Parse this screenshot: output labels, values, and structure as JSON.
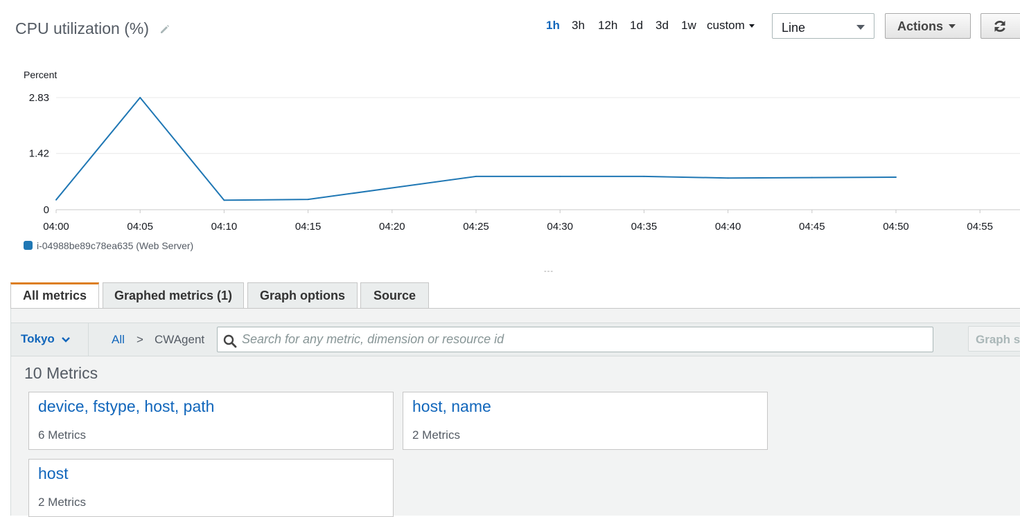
{
  "header": {
    "title": "CPU utilization (%)",
    "time_ranges": [
      "1h",
      "3h",
      "12h",
      "1d",
      "3d",
      "1w"
    ],
    "active_range": "1h",
    "custom_label": "custom",
    "viz_type": "Line",
    "actions_label": "Actions"
  },
  "chart_data": {
    "type": "line",
    "ylabel": "Percent",
    "y_ticks": [
      "2.83",
      "1.42",
      "0"
    ],
    "ylim": [
      0,
      2.83
    ],
    "x_ticks": [
      "04:00",
      "04:05",
      "04:10",
      "04:15",
      "04:20",
      "04:25",
      "04:30",
      "04:35",
      "04:40",
      "04:45",
      "04:50",
      "04:55"
    ],
    "grid": true,
    "legend_position": "bottom-left",
    "series": [
      {
        "name": "i-04988be89c78ea635 (Web Server)",
        "color": "#1f77b4",
        "x": [
          "04:00",
          "04:05",
          "04:10",
          "04:15",
          "04:20",
          "04:25",
          "04:30",
          "04:35",
          "04:40",
          "04:45",
          "04:50"
        ],
        "values": [
          0.25,
          2.83,
          0.24,
          0.26,
          0.55,
          0.84,
          0.84,
          0.84,
          0.8,
          0.81,
          0.82
        ]
      }
    ]
  },
  "tabs": [
    "All metrics",
    "Graphed metrics (1)",
    "Graph options",
    "Source"
  ],
  "browser": {
    "region": "Tokyo",
    "breadcrumb_all": "All",
    "breadcrumb_sep": ">",
    "namespace": "CWAgent",
    "search_placeholder": "Search for any metric, dimension or resource id",
    "graph_search_label": "Graph search",
    "metrics_count": "10 Metrics",
    "cards": [
      {
        "title": "device, fstype, host, path",
        "count": "6 Metrics"
      },
      {
        "title": "host, name",
        "count": "2 Metrics"
      },
      {
        "title": "host",
        "count": "2 Metrics"
      }
    ]
  }
}
